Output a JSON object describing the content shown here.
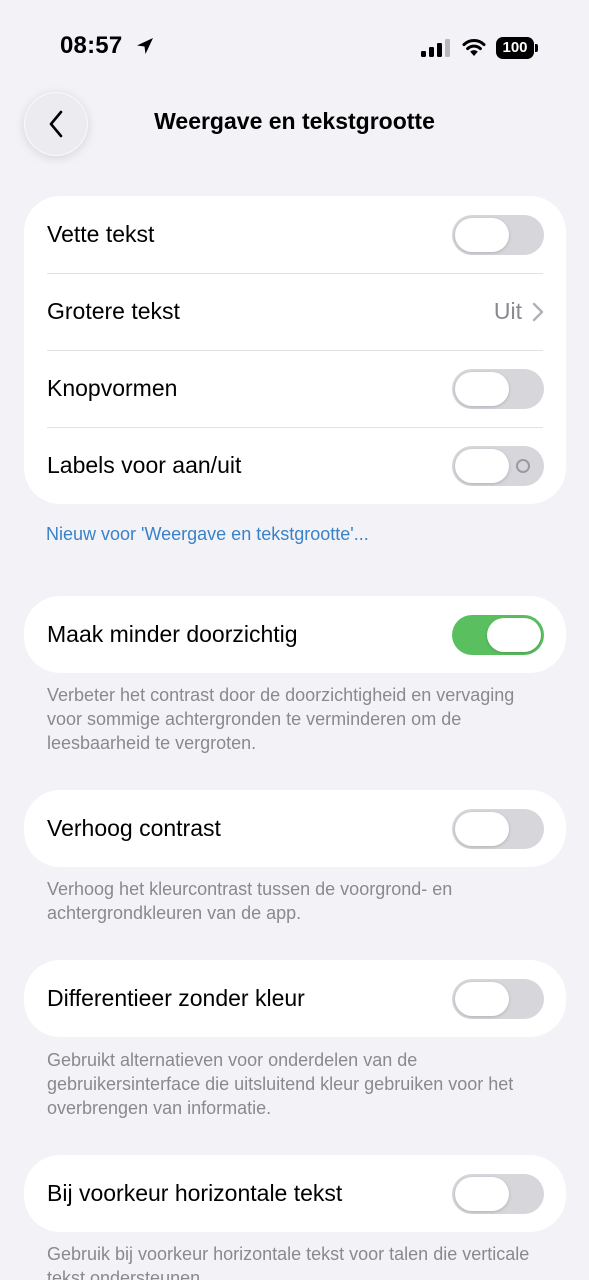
{
  "status_bar": {
    "time": "08:57",
    "battery": "100"
  },
  "nav": {
    "title": "Weergave en tekstgrootte"
  },
  "group1": {
    "rows": [
      {
        "label": "Vette tekst",
        "toggle": "off"
      },
      {
        "label": "Grotere tekst",
        "value": "Uit"
      },
      {
        "label": "Knopvormen",
        "toggle": "off"
      },
      {
        "label": "Labels voor aan/uit",
        "toggle": "off"
      }
    ]
  },
  "whats_new_link": "Nieuw voor 'Weergave en tekstgrootte'...",
  "reduce_transparency": {
    "label": "Maak minder doorzichtig",
    "toggle": "on",
    "footnote": "Verbeter het contrast door de doorzichtigheid en vervaging voor sommige achtergronden te verminderen om de leesbaarheid te vergroten."
  },
  "increase_contrast": {
    "label": "Verhoog contrast",
    "toggle": "off",
    "footnote": "Verhoog het kleurcontrast tussen de voorgrond- en achtergrondkleuren van de app."
  },
  "differentiate_color": {
    "label": "Differentieer zonder kleur",
    "toggle": "off",
    "footnote": "Gebruikt alternatieven voor onderdelen van de gebruikersinterface die uitsluitend kleur gebruiken voor het overbrengen van informatie."
  },
  "prefer_horizontal": {
    "label": "Bij voorkeur horizontale tekst",
    "toggle": "off",
    "footnote": "Gebruik bij voorkeur horizontale tekst voor talen die verticale tekst ondersteunen."
  },
  "colors": {
    "accent_green": "#5ac05f",
    "link_blue": "#3a82c8",
    "background": "#f2f2f7"
  },
  "icons": [
    "location-arrow-icon",
    "cellular-signal-icon",
    "wifi-icon",
    "battery-icon",
    "chevron-left-icon",
    "chevron-right-icon"
  ]
}
